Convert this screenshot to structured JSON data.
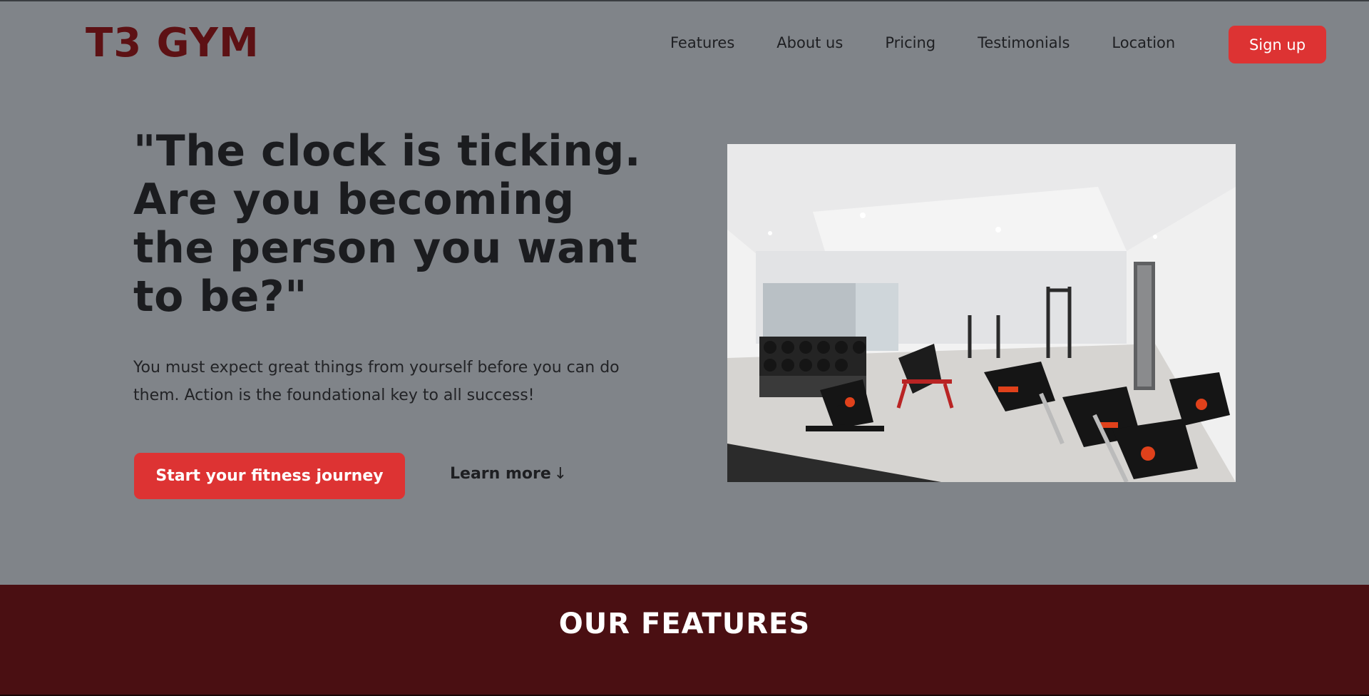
{
  "header": {
    "logo": "T3 GYM",
    "nav": [
      {
        "label": "Features"
      },
      {
        "label": "About us"
      },
      {
        "label": "Pricing"
      },
      {
        "label": "Testimonials"
      },
      {
        "label": "Location"
      }
    ],
    "signup_label": "Sign up"
  },
  "hero": {
    "title": "\"The clock is ticking. Are you becoming the person you want to be?\"",
    "text": "You must expect great things from yourself before you can do them. Action is the foundational key to all success!",
    "cta_label": "Start your fitness journey",
    "learn_label": "Learn more",
    "learn_arrow": "↓"
  },
  "features": {
    "title": "OUR FEATURES"
  },
  "colors": {
    "background": "#808489",
    "brand": "#5d1114",
    "accent": "#dd3333",
    "band": "#4a0f12"
  }
}
